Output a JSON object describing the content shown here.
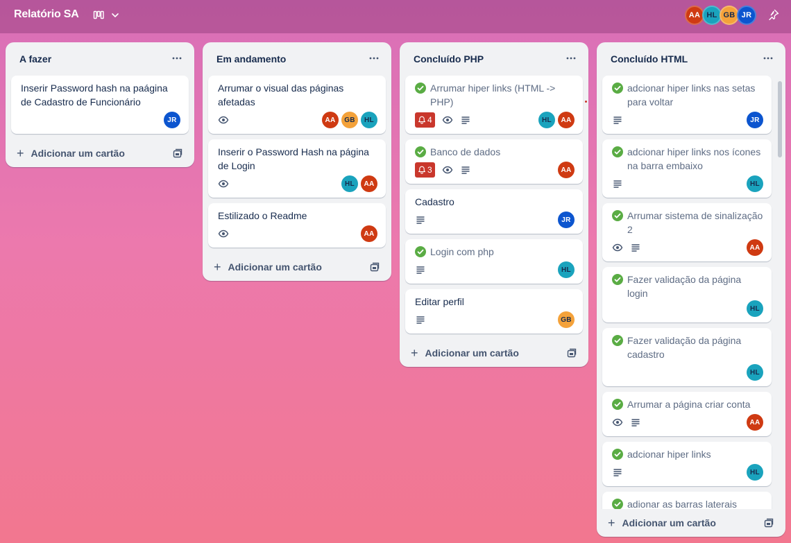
{
  "header": {
    "board_title": "Relatório SA",
    "members": [
      "AA",
      "HL",
      "GB",
      "JR"
    ]
  },
  "lists": [
    {
      "title": "A fazer",
      "add_label": "Adicionar um cartão",
      "cards": [
        {
          "title": "Inserir Password hash na paágina de Cadastro de Funcionário",
          "avatars": [
            "JR"
          ]
        }
      ]
    },
    {
      "title": "Em andamento",
      "add_label": "Adicionar um cartão",
      "cards": [
        {
          "title": "Arrumar o visual das páginas afetadas",
          "avatars": [
            "AA",
            "GB",
            "HL"
          ]
        },
        {
          "title": "Inserir o Password Hash na página de Login",
          "avatars": [
            "HL",
            "AA"
          ]
        },
        {
          "title": "Estilizado o Readme",
          "avatars": [
            "AA"
          ]
        }
      ]
    },
    {
      "title": "Concluído PHP",
      "add_label": "Adicionar um cartão",
      "cards": [
        {
          "title": "Arrumar hiper links (HTML -> PHP)",
          "alert_count": "4",
          "avatars": [
            "HL",
            "AA"
          ]
        },
        {
          "title": "Banco de dados",
          "alert_count": "3",
          "avatars": [
            "AA"
          ]
        },
        {
          "title": "Cadastro",
          "avatars": [
            "JR"
          ]
        },
        {
          "title": "Login com php",
          "avatars": [
            "HL"
          ]
        },
        {
          "title": "Editar perfil",
          "avatars": [
            "GB"
          ]
        }
      ]
    },
    {
      "title": "Concluído HTML",
      "add_label": "Adicionar um cartão",
      "cards": [
        {
          "title": "adcionar hiper links nas setas para voltar",
          "avatars": [
            "JR"
          ]
        },
        {
          "title": "adcionar hiper links nos ícones na barra embaixo",
          "avatars": [
            "HL"
          ]
        },
        {
          "title": "Arrumar sistema de sinalização 2",
          "avatars": [
            "AA"
          ]
        },
        {
          "title": "Fazer validação da página login",
          "avatars": [
            "HL"
          ]
        },
        {
          "title": "Fazer validação da página cadastro",
          "avatars": [
            "HL"
          ]
        },
        {
          "title": "Arrumar a página criar conta",
          "avatars": [
            "AA"
          ]
        },
        {
          "title": "adcionar hiper links",
          "avatars": [
            "HL"
          ]
        },
        {
          "title": "adionar as barras laterais",
          "avatars": []
        }
      ]
    }
  ],
  "colors": {
    "complete_green": "#5aac44",
    "alert_red": "#c9372c",
    "avatar_aa": "#cf3a12",
    "avatar_gb": "#f4a23a",
    "avatar_hl": "#1aa3bd",
    "avatar_jr": "#0c55cf"
  }
}
